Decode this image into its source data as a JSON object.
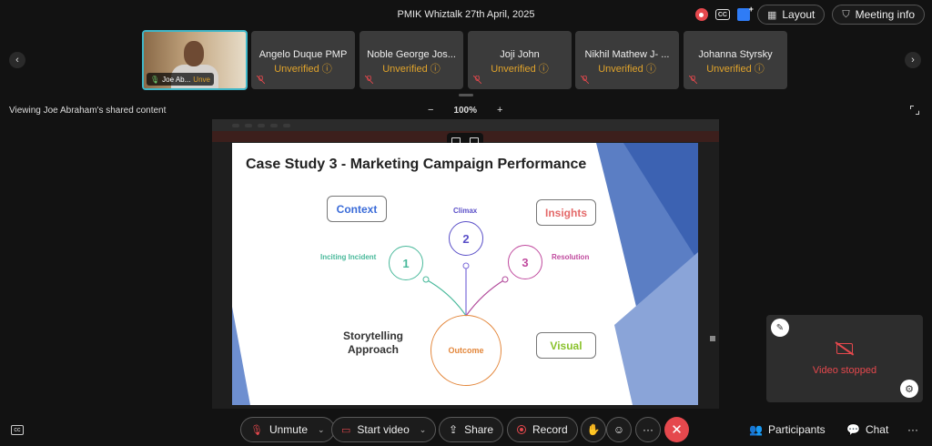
{
  "meeting": {
    "title": "PMIK Whiztalk 27th April, 2025",
    "layout_label": "Layout",
    "meeting_info_label": "Meeting info"
  },
  "self_tile": {
    "name": "Joe Ab...",
    "status": "Unve"
  },
  "participants": [
    {
      "name": "Angelo Duque PMP",
      "status": "Unverified"
    },
    {
      "name": "Noble George Jos...",
      "status": "Unverified"
    },
    {
      "name": "Joji John",
      "status": "Unverified"
    },
    {
      "name": "Nikhil Mathew J- ...",
      "status": "Unverified"
    },
    {
      "name": "Johanna Styrsky",
      "status": "Unverified"
    }
  ],
  "share": {
    "viewing_label": "Viewing Joe Abraham's shared content",
    "zoom_minus": "−",
    "zoom_level": "100%",
    "zoom_plus": "+"
  },
  "slide": {
    "title": "Case Study 3 - Marketing Campaign Performance",
    "context": "Context",
    "insights": "Insights",
    "visual": "Visual",
    "climax": "Climax",
    "climax_num": "2",
    "inciting": "Inciting Incident",
    "inciting_num": "1",
    "resolution": "Resolution",
    "resolution_num": "3",
    "outcome": "Outcome",
    "story_line1": "Storytelling",
    "story_line2": "Approach"
  },
  "video": {
    "stopped_label": "Video stopped"
  },
  "controls": {
    "unmute": "Unmute",
    "start_video": "Start video",
    "share": "Share",
    "record": "Record",
    "participants": "Participants",
    "chat": "Chat",
    "more": "···"
  }
}
